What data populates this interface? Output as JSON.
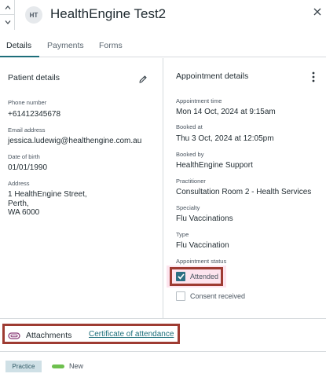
{
  "header": {
    "avatar_initials": "HT",
    "title": "HealthEngine Test2"
  },
  "tabs": [
    {
      "label": "Details",
      "active": true
    },
    {
      "label": "Payments",
      "active": false
    },
    {
      "label": "Forms",
      "active": false
    }
  ],
  "patient": {
    "section_title": "Patient details",
    "phone_label": "Phone number",
    "phone": "+61412345678",
    "email_label": "Email address",
    "email": "jessica.ludewig@healthengine.com.au",
    "dob_label": "Date of birth",
    "dob": "01/01/1990",
    "address_label": "Address",
    "address_line1": "1 HealthEngine Street,",
    "address_line2": "Perth,",
    "address_line3": "WA 6000"
  },
  "appointment": {
    "section_title": "Appointment details",
    "time_label": "Appointment time",
    "time": "Mon 14 Oct, 2024 at 9:15am",
    "booked_at_label": "Booked at",
    "booked_at": "Thu 3 Oct, 2024 at 12:05pm",
    "booked_by_label": "Booked by",
    "booked_by": "HealthEngine Support",
    "practitioner_label": "Practitioner",
    "practitioner": "Consultation Room 2 - Health Services",
    "specialty_label": "Specialty",
    "specialty": "Flu Vaccinations",
    "type_label": "Type",
    "type": "Flu Vaccination",
    "status_label": "Appointment status",
    "attended_label": "Attended",
    "attended_checked": true,
    "consent_label": "Consent received",
    "consent_checked": false
  },
  "attachments": {
    "label": "Attachments",
    "link": "Certificate of attendance"
  },
  "footer": {
    "practice_badge": "Practice",
    "new_label": "New"
  },
  "colors": {
    "accent": "#1d6e7a",
    "checkbox_checked": "#2c6e82",
    "highlight_border": "#9e3b32",
    "status_new": "#6ec04e"
  }
}
